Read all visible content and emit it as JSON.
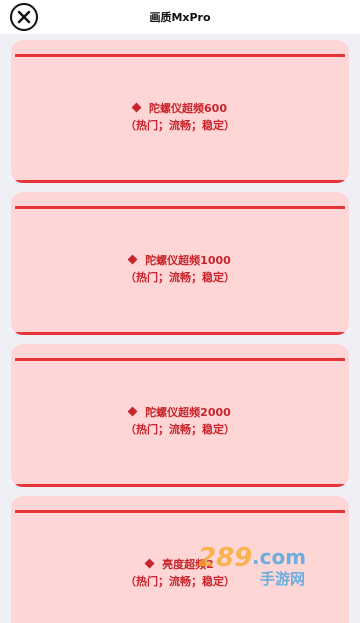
{
  "header": {
    "title": "画质MxPro",
    "close_icon": "close-circle-icon"
  },
  "colors": {
    "card_bg": "#ffd6d6",
    "accent_line": "#e8333a",
    "text": "#c8242b"
  },
  "items": [
    {
      "name": "陀螺仪超频600",
      "tags": "（热门；流畅；稳定）"
    },
    {
      "name": "陀螺仪超频1000",
      "tags": "（热门；流畅；稳定）"
    },
    {
      "name": "陀螺仪超频2000",
      "tags": "（热门；流畅；稳定）"
    },
    {
      "name": "亮度超频2",
      "tags": "（热门；流畅；稳定）"
    }
  ],
  "watermark": {
    "logo": "289.com",
    "subtitle": "手游网"
  }
}
